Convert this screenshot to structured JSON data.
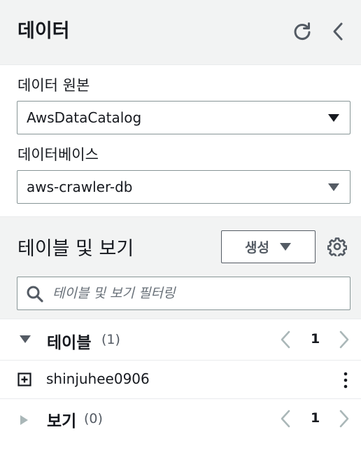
{
  "header": {
    "title": "데이터",
    "refresh_icon": "refresh-icon",
    "collapse_icon": "chevron-left-icon"
  },
  "source": {
    "data_source_label": "데이터 원본",
    "data_source_value": "AwsDataCatalog",
    "database_label": "데이터베이스",
    "database_value": "aws-crawler-db"
  },
  "tables_and_views": {
    "heading": "테이블 및 보기",
    "create_button": "생성",
    "settings_icon": "gear-icon",
    "search_placeholder": "테이블 및 보기 필터링",
    "search_value": ""
  },
  "tables_group": {
    "title": "테이블",
    "count": "(1)",
    "page": "1",
    "items": [
      {
        "name": "shinjuhee0906"
      }
    ]
  },
  "views_group": {
    "title": "보기",
    "count": "(0)",
    "page": "1"
  },
  "colors": {
    "header_bg": "#f2f3f3",
    "text": "#16191f",
    "muted": "#545b64",
    "border": "#879596",
    "disabled": "#aab7b8"
  }
}
